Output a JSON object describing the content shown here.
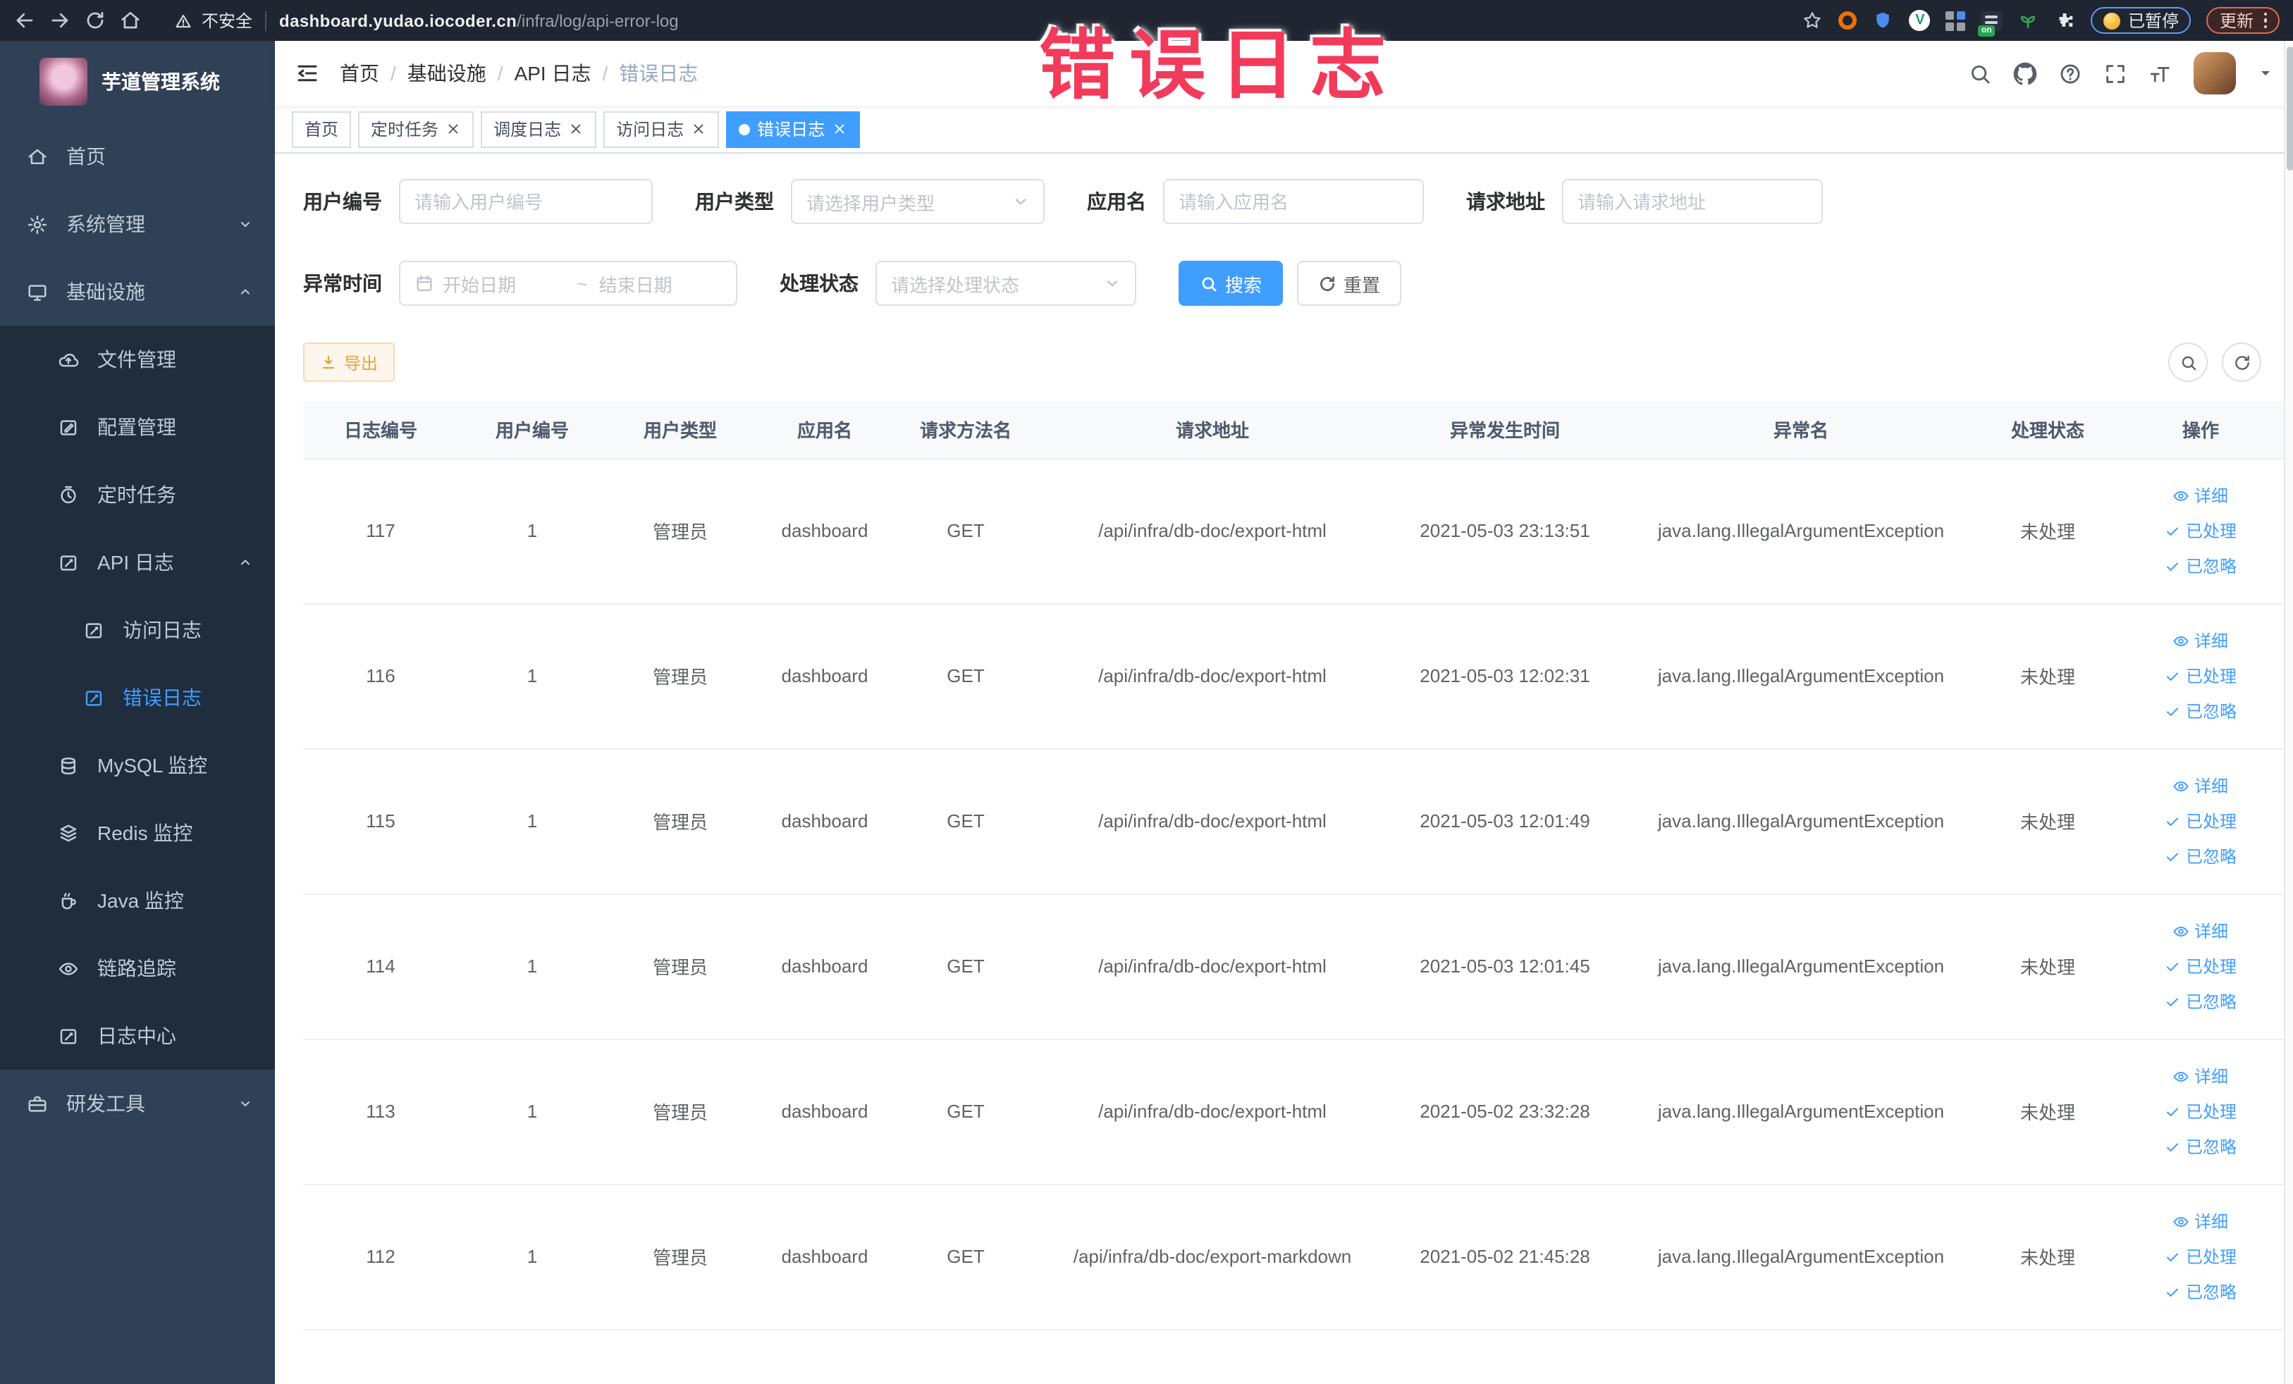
{
  "browser": {
    "security_label": "不安全",
    "url_domain": "dashboard.yudao.iocoder.cn",
    "url_path": "/infra/log/api-error-log",
    "ext_on_label": "on",
    "paused_label": "已暂停",
    "update_label": "更新"
  },
  "annotation": {
    "text": "错误日志",
    "color": "#f23a5b"
  },
  "app": {
    "title": "芋道管理系统"
  },
  "sidebar": {
    "items": [
      {
        "label": "首页",
        "icon": "home-icon",
        "level": 0
      },
      {
        "label": "系统管理",
        "icon": "gear-icon",
        "level": 0,
        "arrow": "down"
      },
      {
        "label": "基础设施",
        "icon": "monitor-icon",
        "level": 0,
        "arrow": "up"
      },
      {
        "label": "文件管理",
        "icon": "cloud-upload-icon",
        "level": 1
      },
      {
        "label": "配置管理",
        "icon": "config-edit-icon",
        "level": 1
      },
      {
        "label": "定时任务",
        "icon": "timer-icon",
        "level": 1
      },
      {
        "label": "API 日志",
        "icon": "api-log-icon",
        "level": 1,
        "arrow": "up"
      },
      {
        "label": "访问日志",
        "icon": "access-log-icon",
        "level": 2
      },
      {
        "label": "错误日志",
        "icon": "error-log-icon",
        "level": 2,
        "active": true
      },
      {
        "label": "MySQL 监控",
        "icon": "mysql-icon",
        "level": 1
      },
      {
        "label": "Redis 监控",
        "icon": "redis-icon",
        "level": 1
      },
      {
        "label": "Java 监控",
        "icon": "java-icon",
        "level": 1
      },
      {
        "label": "链路追踪",
        "icon": "trace-eye-icon",
        "level": 1
      },
      {
        "label": "日志中心",
        "icon": "log-center-icon",
        "level": 1
      },
      {
        "label": "研发工具",
        "icon": "toolbox-icon",
        "level": 0,
        "arrow": "down"
      }
    ]
  },
  "breadcrumb": {
    "items": [
      "首页",
      "基础设施",
      "API 日志",
      "错误日志"
    ]
  },
  "tabs": [
    {
      "label": "首页",
      "closable": false,
      "active": false
    },
    {
      "label": "定时任务",
      "closable": true,
      "active": false
    },
    {
      "label": "调度日志",
      "closable": true,
      "active": false
    },
    {
      "label": "访问日志",
      "closable": true,
      "active": false
    },
    {
      "label": "错误日志",
      "closable": true,
      "active": true
    }
  ],
  "filters": {
    "user_id_label": "用户编号",
    "user_id_placeholder": "请输入用户编号",
    "user_type_label": "用户类型",
    "user_type_placeholder": "请选择用户类型",
    "app_name_label": "应用名",
    "app_name_placeholder": "请输入应用名",
    "request_url_label": "请求地址",
    "request_url_placeholder": "请输入请求地址",
    "time_label": "异常时间",
    "time_start_placeholder": "开始日期",
    "time_separator": "~",
    "time_end_placeholder": "结束日期",
    "status_label": "处理状态",
    "status_placeholder": "请选择处理状态",
    "search_label": "搜索",
    "reset_label": "重置"
  },
  "actions_bar": {
    "export_label": "导出"
  },
  "table": {
    "columns": [
      "日志编号",
      "用户编号",
      "用户类型",
      "应用名",
      "请求方法名",
      "请求地址",
      "异常发生时间",
      "异常名",
      "处理状态",
      "操作"
    ],
    "row_actions": [
      "详细",
      "已处理",
      "已忽略"
    ],
    "rows": [
      [
        "117",
        "1",
        "管理员",
        "dashboard",
        "GET",
        "/api/infra/db-doc/export-html",
        "2021-05-03 23:13:51",
        "java.lang.IllegalArgumentException",
        "未处理"
      ],
      [
        "116",
        "1",
        "管理员",
        "dashboard",
        "GET",
        "/api/infra/db-doc/export-html",
        "2021-05-03 12:02:31",
        "java.lang.IllegalArgumentException",
        "未处理"
      ],
      [
        "115",
        "1",
        "管理员",
        "dashboard",
        "GET",
        "/api/infra/db-doc/export-html",
        "2021-05-03 12:01:49",
        "java.lang.IllegalArgumentException",
        "未处理"
      ],
      [
        "114",
        "1",
        "管理员",
        "dashboard",
        "GET",
        "/api/infra/db-doc/export-html",
        "2021-05-03 12:01:45",
        "java.lang.IllegalArgumentException",
        "未处理"
      ],
      [
        "113",
        "1",
        "管理员",
        "dashboard",
        "GET",
        "/api/infra/db-doc/export-html",
        "2021-05-02 23:32:28",
        "java.lang.IllegalArgumentException",
        "未处理"
      ],
      [
        "112",
        "1",
        "管理员",
        "dashboard",
        "GET",
        "/api/infra/db-doc/export-markdown",
        "2021-05-02 21:45:28",
        "java.lang.IllegalArgumentException",
        "未处理"
      ]
    ]
  },
  "colors": {
    "primary": "#409eff",
    "warning": "#e6a23c",
    "sidebar_bg": "#304156",
    "submenu_bg": "#1f2d3d"
  }
}
